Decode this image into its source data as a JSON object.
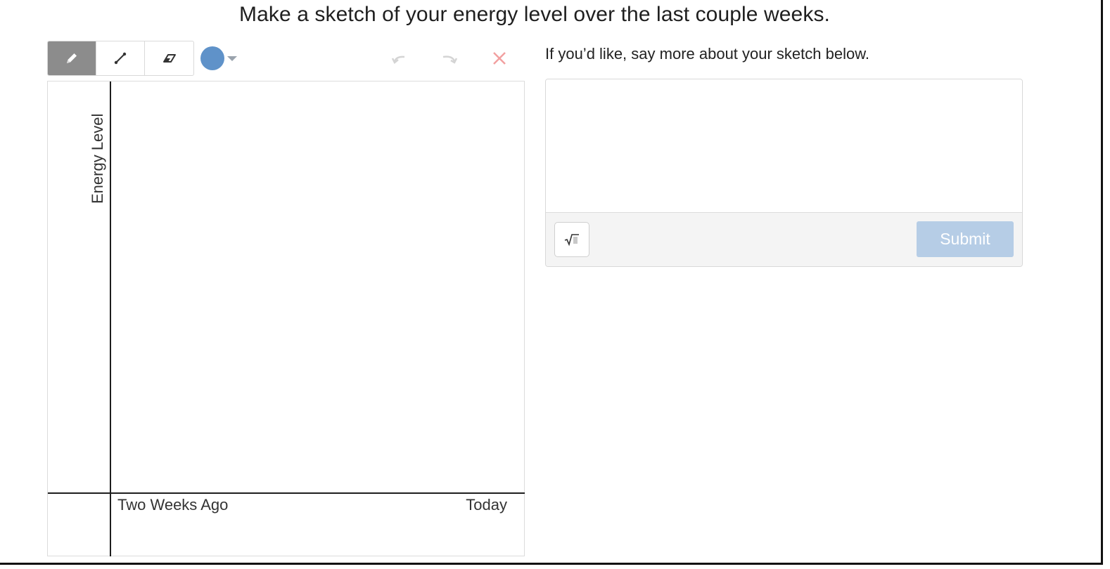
{
  "prompt": {
    "title": "Make a sketch of your energy level over the last couple weeks."
  },
  "toolbar": {
    "tools": [
      {
        "icon": "pencil-icon",
        "active": true
      },
      {
        "icon": "line-icon",
        "active": false
      },
      {
        "icon": "eraser-icon",
        "active": false
      }
    ],
    "current_color": "#5f92c9",
    "actions": [
      "undo-icon",
      "redo-icon",
      "clear-icon"
    ]
  },
  "sketch": {
    "y_axis_label": "Energy Level",
    "x_start_label": "Two Weeks Ago",
    "x_end_label": "Today"
  },
  "response": {
    "label": "If you’d like, say more about your sketch below.",
    "input_value": "",
    "submit_label": "Submit",
    "math_icon": "square-root-icon"
  },
  "colors": {
    "active_tool": "#8c8c8c",
    "clear_icon": "#f2a0a0",
    "submit_disabled": "#b6cde6"
  }
}
